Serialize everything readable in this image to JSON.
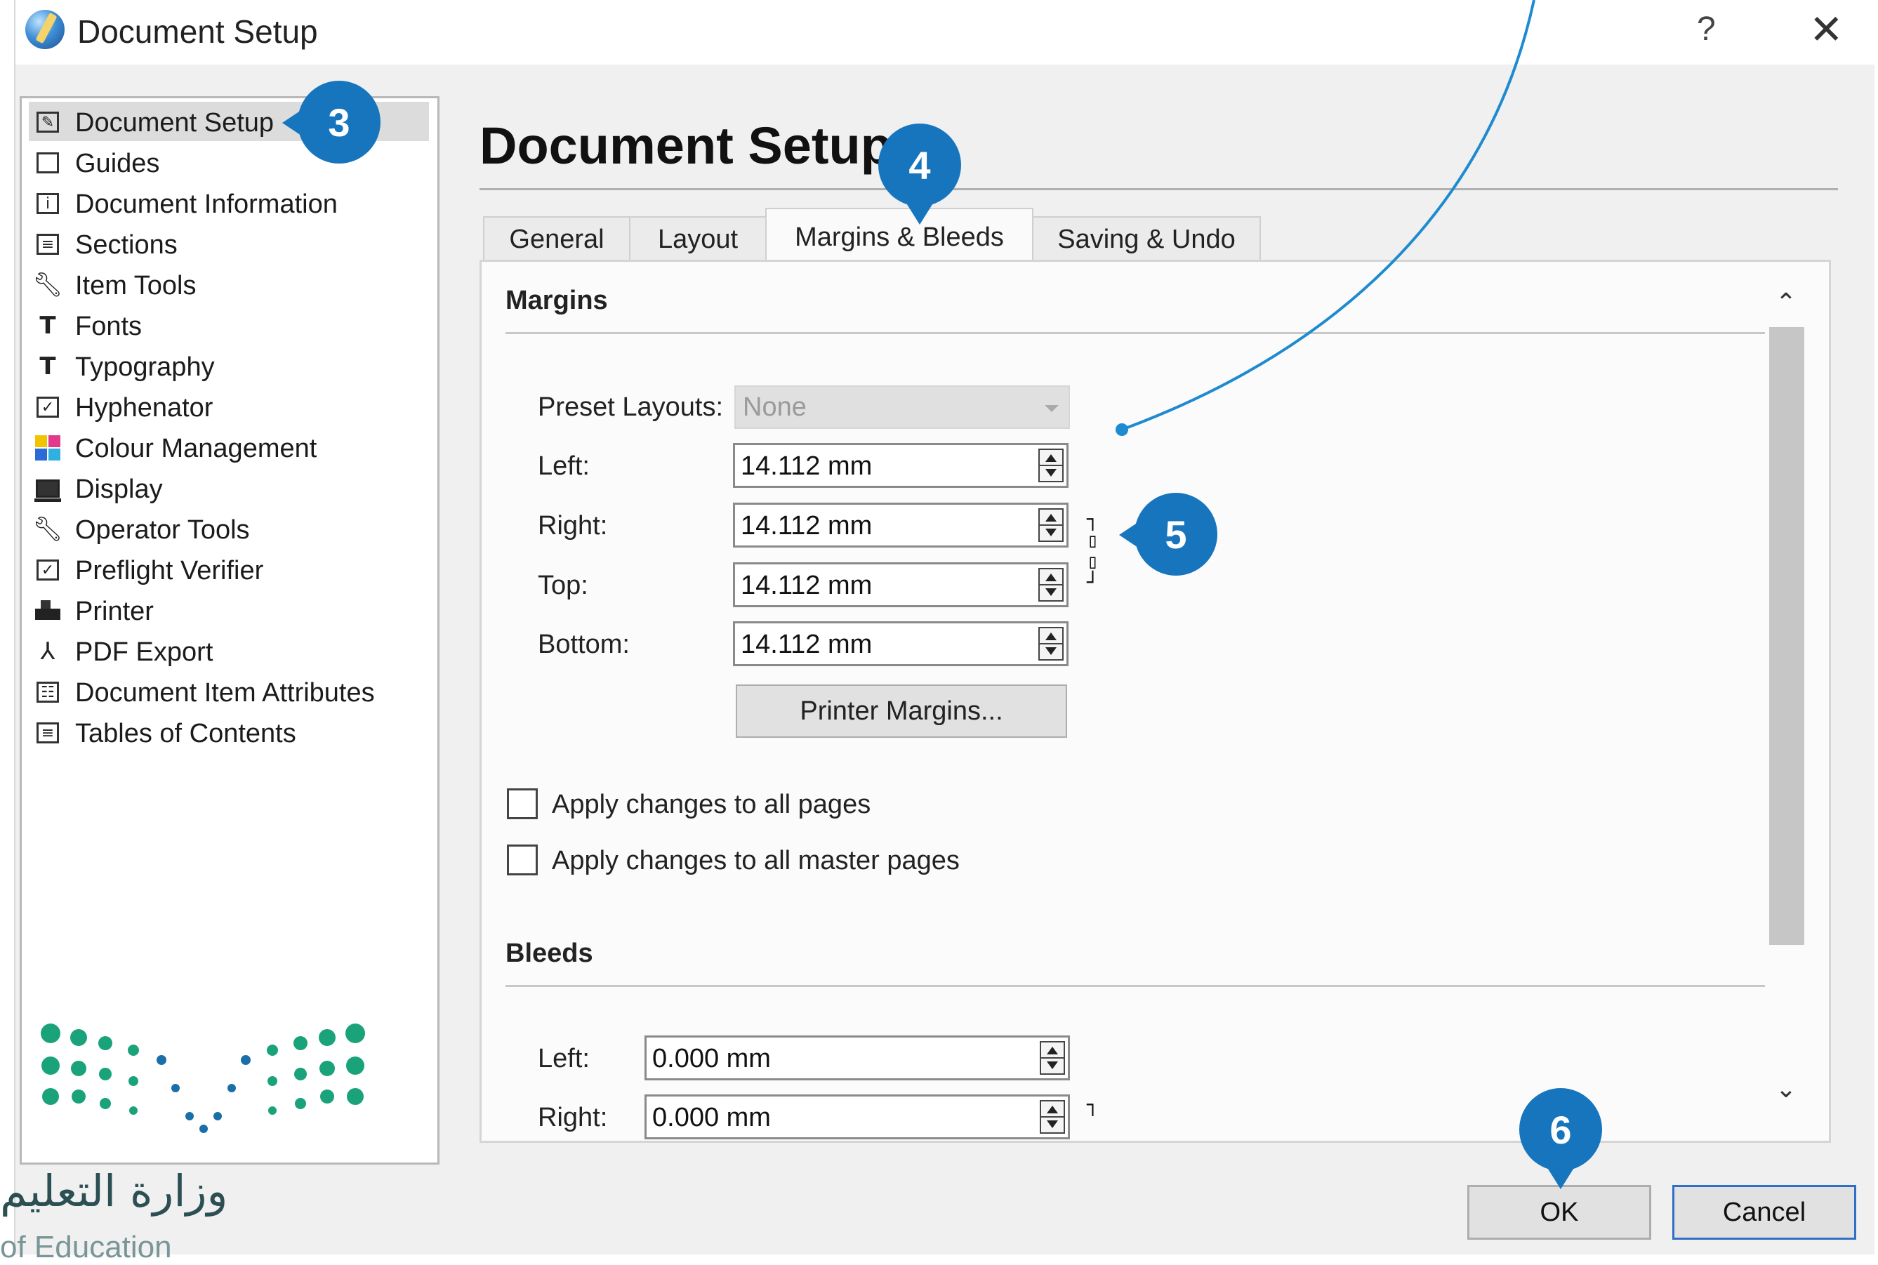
{
  "window": {
    "title": "Document Setup",
    "help_glyph": "?",
    "close_glyph": "✕"
  },
  "sidebar": {
    "items": [
      {
        "label": "Document Setup",
        "icon": "document-setup-icon",
        "selected": true
      },
      {
        "label": "Guides",
        "icon": "guides-icon"
      },
      {
        "label": "Document Information",
        "icon": "info-icon"
      },
      {
        "label": "Sections",
        "icon": "sections-icon"
      },
      {
        "label": "Item Tools",
        "icon": "wrench-icon"
      },
      {
        "label": "Fonts",
        "icon": "font-icon"
      },
      {
        "label": "Typography",
        "icon": "typography-icon"
      },
      {
        "label": "Hyphenator",
        "icon": "checkbox-icon"
      },
      {
        "label": "Colour Management",
        "icon": "color-squares-icon"
      },
      {
        "label": "Display",
        "icon": "monitor-icon"
      },
      {
        "label": "Operator Tools",
        "icon": "wrench-icon"
      },
      {
        "label": "Preflight Verifier",
        "icon": "checkbox-icon"
      },
      {
        "label": "Printer",
        "icon": "printer-icon"
      },
      {
        "label": "PDF Export",
        "icon": "pdf-icon"
      },
      {
        "label": "Document Item Attributes",
        "icon": "attributes-icon"
      },
      {
        "label": "Tables of Contents",
        "icon": "toc-icon"
      }
    ]
  },
  "main": {
    "title": "Document Setup",
    "tabs": [
      {
        "label": "General",
        "active": false
      },
      {
        "label": "Layout",
        "active": false
      },
      {
        "label": "Margins & Bleeds",
        "active": true
      },
      {
        "label": "Saving & Undo",
        "active": false
      }
    ],
    "margins": {
      "header": "Margins",
      "preset_label": "Preset Layouts:",
      "preset_value": "None",
      "left_label": "Left:",
      "left_value": "14.112 mm",
      "right_label": "Right:",
      "right_value": "14.112 mm",
      "top_label": "Top:",
      "top_value": "14.112 mm",
      "bottom_label": "Bottom:",
      "bottom_value": "14.112 mm",
      "printer_margins_label": "Printer Margins...",
      "apply_all_pages": "Apply changes to all pages",
      "apply_all_master": "Apply changes to all master pages"
    },
    "bleeds": {
      "header": "Bleeds",
      "left_label": "Left:",
      "left_value": "0.000 mm",
      "right_label": "Right:",
      "right_value": "0.000 mm"
    }
  },
  "buttons": {
    "ok": "OK",
    "cancel": "Cancel"
  },
  "callouts": [
    "3",
    "4",
    "5",
    "6"
  ],
  "branding": {
    "arabic_text": "وزارة التعليم",
    "english_text": "of Education"
  },
  "colors": {
    "callout": "#1775bd",
    "logo_green": "#1aa37a",
    "logo_blue": "#1b6fa8"
  }
}
